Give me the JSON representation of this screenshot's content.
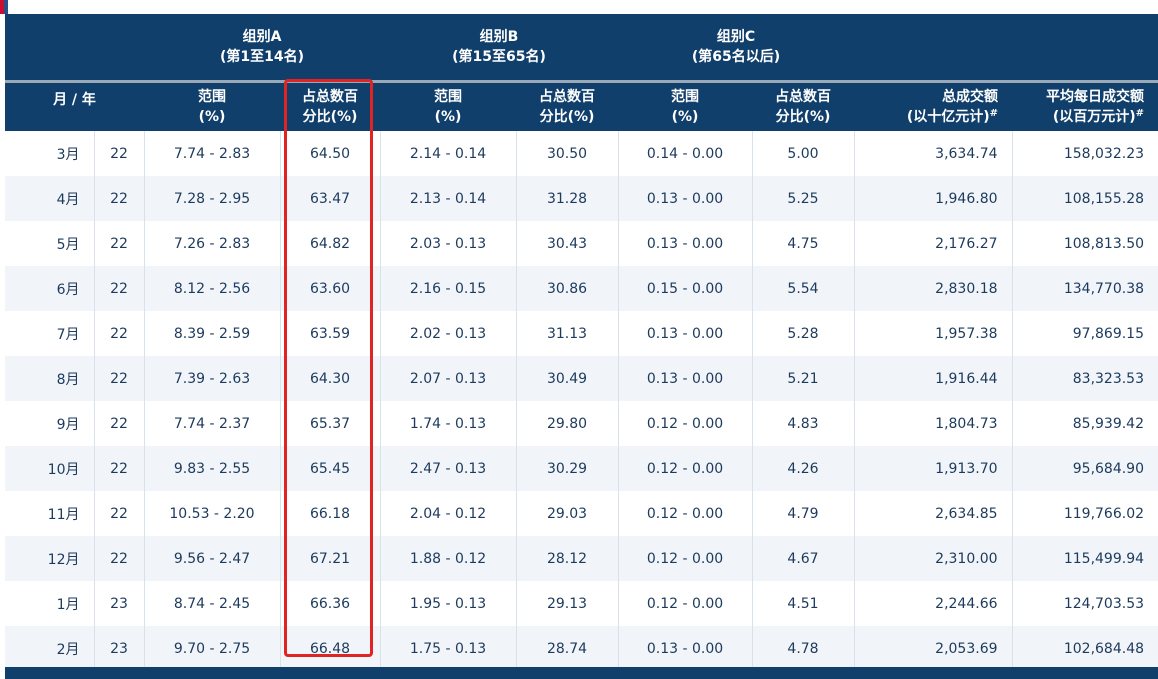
{
  "groups": {
    "a_name": "组别A",
    "a_rank": "(第1至14名)",
    "b_name": "组别B",
    "b_rank": "(第15至65名)",
    "c_name": "组别C",
    "c_rank": "(第65名以后)"
  },
  "columns": {
    "month_year": "月 / 年",
    "range_l1": "范围",
    "range_l2": "(%)",
    "share_l1": "占总数百",
    "share_l2": "分比(%)",
    "turnover_l1": "总成交额",
    "turnover_l2": "(以十亿元计)",
    "daily_l1": "平均每日成交额",
    "daily_l2": "(以百万元计)",
    "footnote_mark": "#"
  },
  "rows": [
    {
      "month": "3月",
      "year": "22",
      "a_range": "7.74 - 2.83",
      "a_share": "64.50",
      "b_range": "2.14 - 0.14",
      "b_share": "30.50",
      "c_range": "0.14 - 0.00",
      "c_share": "5.00",
      "turnover": "3,634.74",
      "daily": "158,032.23"
    },
    {
      "month": "4月",
      "year": "22",
      "a_range": "7.28 - 2.95",
      "a_share": "63.47",
      "b_range": "2.13 - 0.14",
      "b_share": "31.28",
      "c_range": "0.13 - 0.00",
      "c_share": "5.25",
      "turnover": "1,946.80",
      "daily": "108,155.28"
    },
    {
      "month": "5月",
      "year": "22",
      "a_range": "7.26 - 2.83",
      "a_share": "64.82",
      "b_range": "2.03 - 0.13",
      "b_share": "30.43",
      "c_range": "0.13 - 0.00",
      "c_share": "4.75",
      "turnover": "2,176.27",
      "daily": "108,813.50"
    },
    {
      "month": "6月",
      "year": "22",
      "a_range": "8.12 - 2.56",
      "a_share": "63.60",
      "b_range": "2.16 - 0.15",
      "b_share": "30.86",
      "c_range": "0.15 - 0.00",
      "c_share": "5.54",
      "turnover": "2,830.18",
      "daily": "134,770.38"
    },
    {
      "month": "7月",
      "year": "22",
      "a_range": "8.39 - 2.59",
      "a_share": "63.59",
      "b_range": "2.02 - 0.13",
      "b_share": "31.13",
      "c_range": "0.13 - 0.00",
      "c_share": "5.28",
      "turnover": "1,957.38",
      "daily": "97,869.15"
    },
    {
      "month": "8月",
      "year": "22",
      "a_range": "7.39 - 2.63",
      "a_share": "64.30",
      "b_range": "2.07 - 0.13",
      "b_share": "30.49",
      "c_range": "0.13 - 0.00",
      "c_share": "5.21",
      "turnover": "1,916.44",
      "daily": "83,323.53"
    },
    {
      "month": "9月",
      "year": "22",
      "a_range": "7.74 - 2.37",
      "a_share": "65.37",
      "b_range": "1.74 - 0.13",
      "b_share": "29.80",
      "c_range": "0.12 - 0.00",
      "c_share": "4.83",
      "turnover": "1,804.73",
      "daily": "85,939.42"
    },
    {
      "month": "10月",
      "year": "22",
      "a_range": "9.83 - 2.55",
      "a_share": "65.45",
      "b_range": "2.47 - 0.13",
      "b_share": "30.29",
      "c_range": "0.12 - 0.00",
      "c_share": "4.26",
      "turnover": "1,913.70",
      "daily": "95,684.90"
    },
    {
      "month": "11月",
      "year": "22",
      "a_range": "10.53 - 2.20",
      "a_share": "66.18",
      "b_range": "2.04 - 0.12",
      "b_share": "29.03",
      "c_range": "0.12 - 0.00",
      "c_share": "4.79",
      "turnover": "2,634.85",
      "daily": "119,766.02"
    },
    {
      "month": "12月",
      "year": "22",
      "a_range": "9.56 - 2.47",
      "a_share": "67.21",
      "b_range": "1.88 - 0.12",
      "b_share": "28.12",
      "c_range": "0.12 - 0.00",
      "c_share": "4.67",
      "turnover": "2,310.00",
      "daily": "115,499.94"
    },
    {
      "month": "1月",
      "year": "23",
      "a_range": "8.74 - 2.45",
      "a_share": "66.36",
      "b_range": "1.95 - 0.13",
      "b_share": "29.13",
      "c_range": "0.12 - 0.00",
      "c_share": "4.51",
      "turnover": "2,244.66",
      "daily": "124,703.53"
    },
    {
      "month": "2月",
      "year": "23",
      "a_range": "9.70 - 2.75",
      "a_share": "66.48",
      "b_range": "1.75 - 0.13",
      "b_share": "28.74",
      "c_range": "0.13 - 0.00",
      "c_share": "4.78",
      "turnover": "2,053.69",
      "daily": "102,684.48"
    }
  ],
  "colors": {
    "header_bg": "#103f6b",
    "row_alt_bg": "#f1f5f9",
    "highlight_border": "#e02424",
    "text": "#1d3a5c"
  }
}
